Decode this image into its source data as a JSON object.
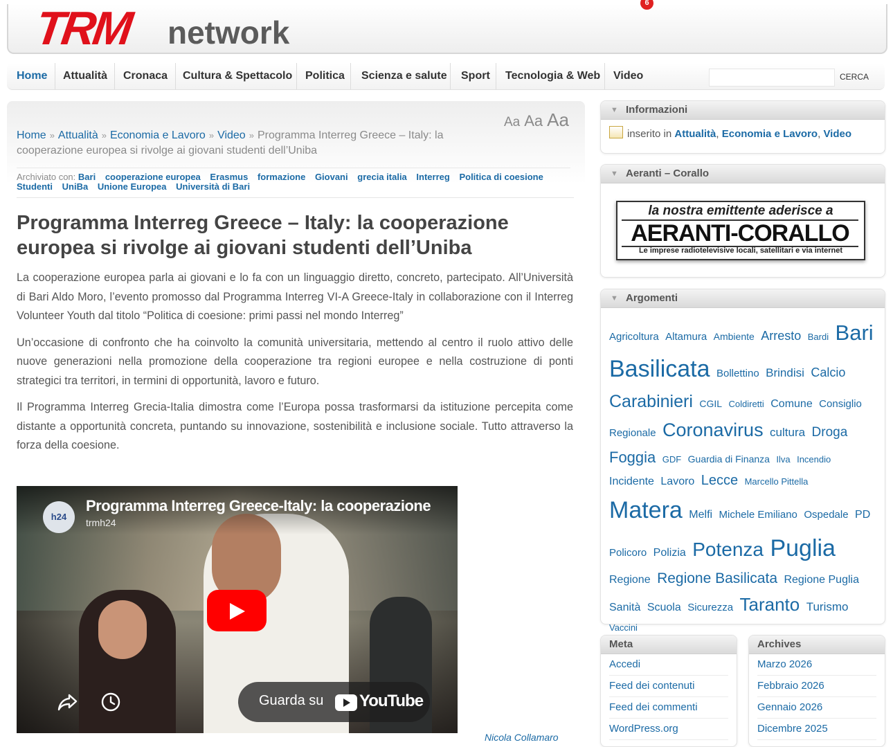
{
  "header": {
    "logo_trm": "TRM",
    "logo_network": "network"
  },
  "nav": {
    "items": [
      "Home",
      "Attualità",
      "Cronaca",
      "Cultura & Spettacolo",
      "Politica",
      "Scienza e salute",
      "Sport",
      "Tecnologia & Web",
      "Video"
    ],
    "video_badge": "6",
    "search_value": "",
    "search_button": "CERCA"
  },
  "font_sizes": [
    "Aa",
    "Aa",
    "Aa"
  ],
  "breadcrumb": {
    "items": [
      "Home",
      "Attualità",
      "Economia e Lavoro",
      "Video"
    ],
    "current": "Programma Interreg Greece – Italy: la cooperazione europea si rivolge ai giovani studenti dell’Uniba",
    "separator": "»"
  },
  "archived": {
    "label": "Archiviato con:",
    "tags": [
      "Bari",
      "cooperazione europea",
      "Erasmus",
      "formazione",
      "Giovani",
      "grecia italia",
      "Interreg",
      "Politica di coesione",
      "Studenti",
      "UniBa",
      "Unione Europea",
      "Università di Bari"
    ]
  },
  "post": {
    "title": "Programma Interreg Greece – Italy: la cooperazione europea si rivolge ai giovani studenti dell’Uniba",
    "paragraphs": [
      "La cooperazione europea parla ai giovani  e lo fa con un linguaggio diretto, concreto, partecipato. All’Università di Bari Aldo Moro, l’evento promosso dal  Programma Interreg VI-A Greece-Italy in collaborazione con il Interreg Volunteer Youth  dal titolo “Politica di coesione: primi passi nel mondo Interreg”",
      "Un’occasione di confronto che ha coinvolto la comunità universitaria, mettendo al centro il ruolo attivo delle nuove generazioni nella promozione della cooperazione tra regioni europee e nella costruzione di ponti strategici tra territori, in termini di opportunità, lavoro e futuro.",
      "Il Programma Interreg Grecia-Italia dimostra come l’Europa possa trasformarsi da istituzione percepita come distante a opportunità concreta, puntando su innovazione, sostenibilità e inclusione sociale. Tutto attraverso la forza della coesione."
    ],
    "author": "Nicola Collamaro"
  },
  "video": {
    "avatar_text": "h24",
    "title": "Programma Interreg Greece-Italy: la cooperazione europea si rivolge ai giovani",
    "channel": "trmh24",
    "watch_label": "Guarda su",
    "youtube_word": "YouTube"
  },
  "sidebar": {
    "informazioni": {
      "title": "Informazioni",
      "prefix": "inserito in",
      "categories": [
        "Attualità",
        "Economia e Lavoro",
        "Video"
      ]
    },
    "aeranti": {
      "title": "Aeranti – Corallo",
      "banner_top": "la nostra emittente aderisce a",
      "banner_main": "AERANTI-CORALLO",
      "banner_bottom": "Le imprese radiotelevisive locali, satellitari e via internet"
    },
    "argomenti": {
      "title": "Argomenti",
      "tags": [
        {
          "label": "Agricoltura",
          "size": 15
        },
        {
          "label": "Altamura",
          "size": 15
        },
        {
          "label": "Ambiente",
          "size": 14
        },
        {
          "label": "Arresto",
          "size": 18
        },
        {
          "label": "Bardi",
          "size": 13
        },
        {
          "label": "Bari",
          "size": 31
        },
        {
          "label": "Basilicata",
          "size": 34
        },
        {
          "label": "Bollettino",
          "size": 15
        },
        {
          "label": "Brindisi",
          "size": 17
        },
        {
          "label": "Calcio",
          "size": 18
        },
        {
          "label": "Carabinieri",
          "size": 25
        },
        {
          "label": "CGIL",
          "size": 14
        },
        {
          "label": "Coldiretti",
          "size": 13
        },
        {
          "label": "Comune",
          "size": 16
        },
        {
          "label": "Consiglio",
          "size": 15
        },
        {
          "label": "Regionale",
          "size": 15
        },
        {
          "label": "Coronavirus",
          "size": 27
        },
        {
          "label": "cultura",
          "size": 17
        },
        {
          "label": "Droga",
          "size": 19
        },
        {
          "label": "Foggia",
          "size": 22
        },
        {
          "label": "GDF",
          "size": 13
        },
        {
          "label": "Guardia di Finanza",
          "size": 14
        },
        {
          "label": "Ilva",
          "size": 13
        },
        {
          "label": "Incendio",
          "size": 13
        },
        {
          "label": "Incidente",
          "size": 16
        },
        {
          "label": "Lavoro",
          "size": 16
        },
        {
          "label": "Lecce",
          "size": 20
        },
        {
          "label": "Marcello Pittella",
          "size": 13
        },
        {
          "label": "Matera",
          "size": 34
        },
        {
          "label": "Melfi",
          "size": 16
        },
        {
          "label": "Michele Emiliano",
          "size": 15
        },
        {
          "label": "Ospedale",
          "size": 15
        },
        {
          "label": "PD",
          "size": 16
        },
        {
          "label": "Policoro",
          "size": 15
        },
        {
          "label": "Polizia",
          "size": 16
        },
        {
          "label": "Potenza",
          "size": 28
        },
        {
          "label": "Puglia",
          "size": 34
        },
        {
          "label": "Regione",
          "size": 16
        },
        {
          "label": "Regione Basilicata",
          "size": 21
        },
        {
          "label": "Regione Puglia",
          "size": 16
        },
        {
          "label": "Sanità",
          "size": 16
        },
        {
          "label": "Scuola",
          "size": 16
        },
        {
          "label": "Sicurezza",
          "size": 15
        },
        {
          "label": "Taranto",
          "size": 26
        },
        {
          "label": "Turismo",
          "size": 17
        },
        {
          "label": "Vaccini",
          "size": 13
        }
      ]
    },
    "meta": {
      "title": "Meta",
      "links": [
        "Accedi",
        "Feed dei contenuti",
        "Feed dei commenti",
        "WordPress.org"
      ]
    },
    "archives": {
      "title": "Archives",
      "links": [
        "Marzo 2026",
        "Febbraio 2026",
        "Gennaio 2026",
        "Dicembre 2025"
      ]
    }
  }
}
